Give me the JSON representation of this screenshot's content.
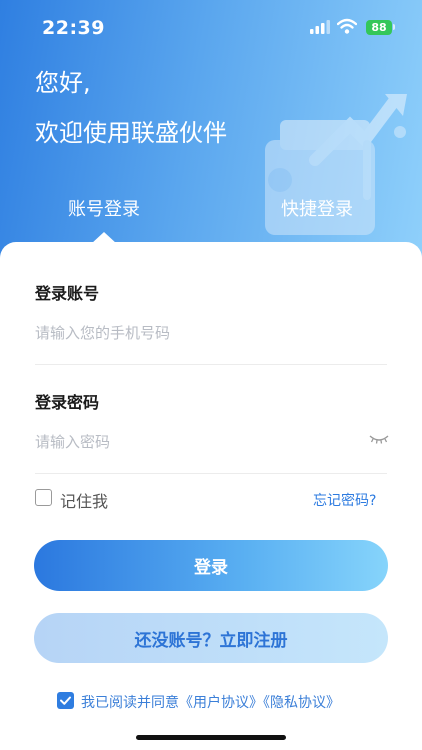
{
  "status_bar": {
    "time": "22:39",
    "battery": "88"
  },
  "hero": {
    "greeting": "您好,",
    "welcome": "欢迎使用联盛伙伴",
    "tabs": [
      {
        "label": "账号登录",
        "active": true
      },
      {
        "label": "快捷登录",
        "active": false
      }
    ]
  },
  "form": {
    "account_label": "登录账号",
    "account_placeholder": "请输入您的手机号码",
    "account_value": "",
    "password_label": "登录密码",
    "password_placeholder": "请输入密码",
    "password_value": "",
    "remember_label": "记住我",
    "remember_checked": false,
    "forgot_label": "忘记密码?",
    "login_button": "登录",
    "register_button": "还没账号？立即注册"
  },
  "agreement": {
    "checked": true,
    "prefix": "我已阅读并同意",
    "user_agreement": "《用户协议》",
    "privacy_agreement": "《隐私协议》"
  },
  "colors": {
    "accent": "#2f7de0",
    "hero_start": "#2f7fe1",
    "hero_end": "#8fd0fb",
    "battery": "#34c759"
  },
  "icons": [
    "signal-icon",
    "wifi-icon",
    "battery-icon",
    "eye-closed-icon",
    "checkbox-icon",
    "checkmark-icon"
  ]
}
